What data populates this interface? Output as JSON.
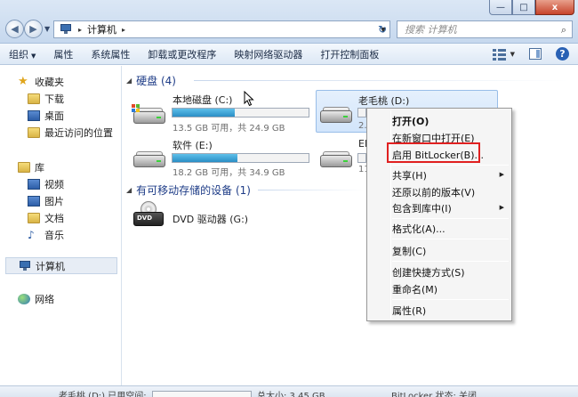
{
  "window": {
    "min_glyph": "—",
    "max_glyph": "□",
    "close_glyph": "x"
  },
  "address": {
    "crumb": "计算机",
    "sep": "▸",
    "search_placeholder": "搜索 计算机"
  },
  "toolbar": {
    "items": [
      "组织",
      "属性",
      "系统属性",
      "卸载或更改程序",
      "映射网络驱动器",
      "打开控制面板"
    ]
  },
  "nav": {
    "favorites": "收藏夹",
    "downloads": "下载",
    "desktop": "桌面",
    "recent": "最近访问的位置",
    "library": "库",
    "videos": "视频",
    "pictures": "图片",
    "documents": "文档",
    "music": "音乐",
    "computer": "计算机",
    "network": "网络"
  },
  "content": {
    "group_hdd": "硬盘 (4)",
    "group_removable": "有可移动存储的设备 (1)",
    "drives": [
      {
        "name": "本地磁盘 (C:)",
        "free": "13.5 GB 可用，共 24.9 GB",
        "used_fraction": 0.46
      },
      {
        "name": "老毛桃 (D:)",
        "free": "2.4",
        "used_fraction": 0.0
      },
      {
        "name": "软件 (E:)",
        "free": "18.2 GB 可用，共 34.9 GB",
        "used_fraction": 0.48
      },
      {
        "name": "EF",
        "free": "11",
        "used_fraction": 0.0
      }
    ],
    "dvd": "DVD 驱动器 (G:)",
    "dvd_label": "DVD"
  },
  "context_menu": {
    "items": [
      {
        "label": "打开(O)"
      },
      {
        "label": "在新窗口中打开(E)"
      },
      {
        "label": "启用 BitLocker(B)..."
      },
      {
        "label": "共享(H)"
      },
      {
        "label": "还原以前的版本(V)"
      },
      {
        "label": "包含到库中(I)"
      },
      {
        "label": "格式化(A)..."
      },
      {
        "label": "复制(C)"
      },
      {
        "label": "创建快捷方式(S)"
      },
      {
        "label": "重命名(M)"
      },
      {
        "label": "属性(R)"
      }
    ],
    "highlight_color": "#e02020"
  },
  "status": {
    "left": "老毛桃 (D:) 已用空间:",
    "mid": "总大小: 3.45 GB",
    "right": "BitLocker 状态: 关闭"
  }
}
